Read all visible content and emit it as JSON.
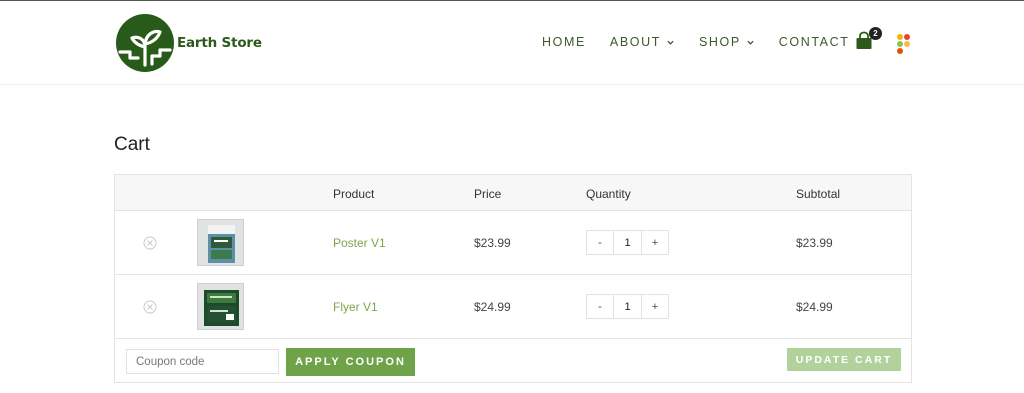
{
  "brand": {
    "name": "Earth Store",
    "logo_icon": "earth-tree-logo",
    "color": "#2d5a1b"
  },
  "nav": {
    "items": [
      {
        "label": "HOME",
        "has_dropdown": false
      },
      {
        "label": "ABOUT",
        "has_dropdown": true
      },
      {
        "label": "SHOP",
        "has_dropdown": true
      },
      {
        "label": "CONTACT",
        "has_dropdown": false
      }
    ],
    "cart_icon": "shopping-bag-icon",
    "cart_count": "2",
    "extra_icon": "colorful-dots-icon"
  },
  "page": {
    "title": "Cart"
  },
  "cart": {
    "headers": {
      "product": "Product",
      "price": "Price",
      "quantity": "Quantity",
      "subtotal": "Subtotal"
    },
    "items": [
      {
        "name": "Poster V1",
        "price": "$23.99",
        "quantity": "1",
        "subtotal": "$23.99",
        "minus": "-",
        "plus": "+"
      },
      {
        "name": "Flyer V1",
        "price": "$24.99",
        "quantity": "1",
        "subtotal": "$24.99",
        "minus": "-",
        "plus": "+"
      }
    ],
    "coupon_placeholder": "Coupon code",
    "apply_coupon_label": "APPLY COUPON",
    "update_cart_label": "UPDATE CART"
  },
  "colors": {
    "accent": "#6fa34a",
    "accent_disabled": "#b2d29c",
    "link": "#7aa64c",
    "nav_text": "#3a5a2c"
  }
}
